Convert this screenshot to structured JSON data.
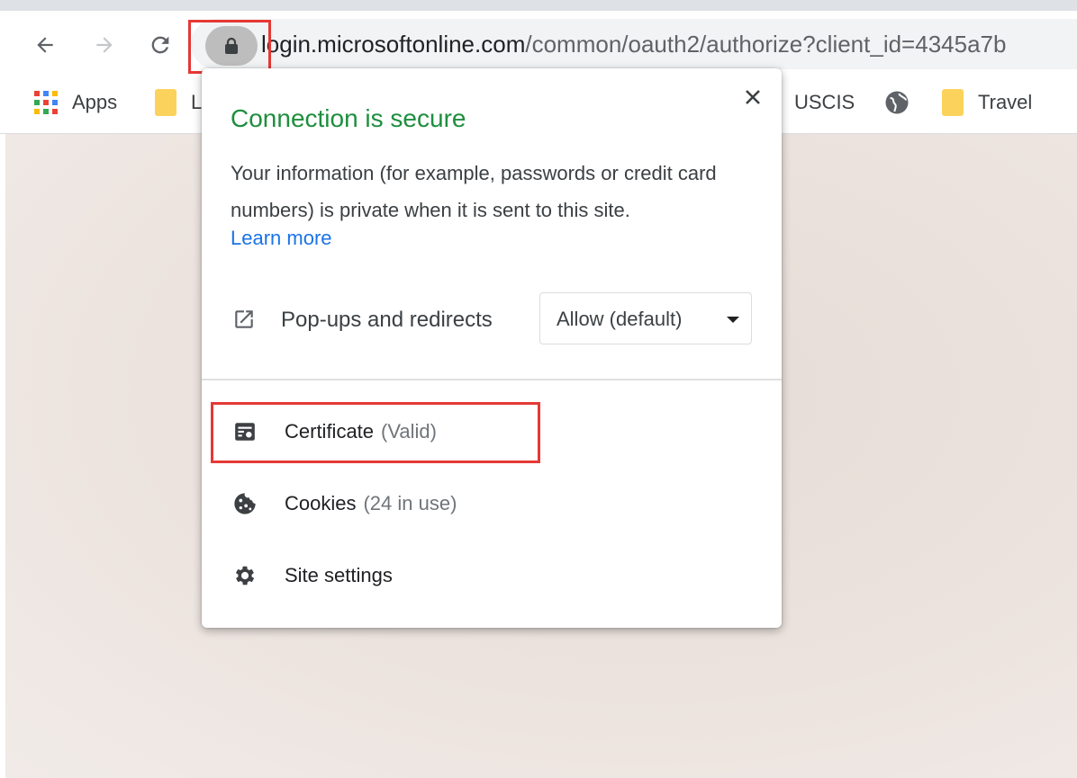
{
  "browser": {
    "url_host": "login.microsoftonline.com",
    "url_rest": "/common/oauth2/authorize?client_id=4345a7b"
  },
  "bookmarks": [
    {
      "label": "Apps",
      "icon": "apps-grid-icon"
    },
    {
      "label": "L",
      "icon": "folder-icon"
    },
    {
      "label": "USCIS",
      "icon": "none"
    },
    {
      "label": "",
      "icon": "globe-icon"
    },
    {
      "label": "Travel",
      "icon": "folder-icon"
    }
  ],
  "popup": {
    "title": "Connection is secure",
    "description": "Your information (for example, passwords or credit card numbers) is private when it is sent to this site.",
    "learn_more": "Learn more",
    "permission": {
      "label": "Pop-ups and redirects",
      "value": "Allow (default)"
    },
    "items": [
      {
        "label": "Certificate",
        "sub": "(Valid)",
        "icon": "certificate-icon"
      },
      {
        "label": "Cookies",
        "sub": "(24 in use)",
        "icon": "cookie-icon"
      },
      {
        "label": "Site settings",
        "sub": "",
        "icon": "gear-icon"
      }
    ]
  },
  "colors": {
    "secure_green": "#1e8e3e",
    "link_blue": "#1a73e8",
    "highlight_red": "#e53935"
  }
}
